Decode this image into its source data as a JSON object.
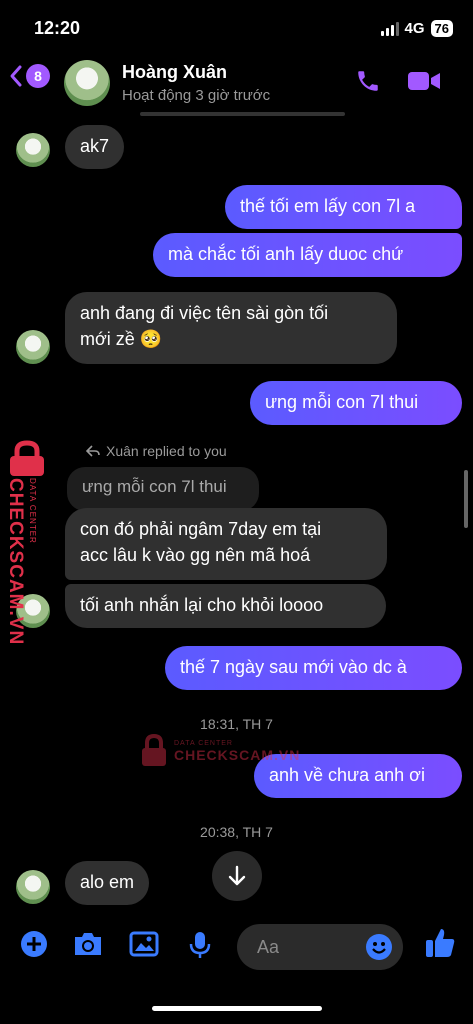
{
  "status": {
    "time": "12:20",
    "network": "4G",
    "battery": "76"
  },
  "header": {
    "back_badge": "8",
    "name": "Hoàng Xuân",
    "subtitle": "Hoạt động 3 giờ trước"
  },
  "messages": [
    {
      "from": "in",
      "text": "ak7"
    },
    {
      "from": "out",
      "text": "thế tối em lấy con 7l a"
    },
    {
      "from": "out",
      "text": "mà chắc tối anh lấy duoc chứ"
    },
    {
      "from": "in",
      "line1": "anh đang đi việc tên sài gòn tối",
      "line2": "mới zề 🥺"
    },
    {
      "from": "out",
      "text": "ưng mỗi con 7l thui"
    },
    {
      "from": "in",
      "reply_label": "Xuân replied to you",
      "quoted": "ưng mỗi con 7l thui",
      "line1": "con đó phải ngâm 7day em tại",
      "line2": "acc lâu k vào gg nên mã hoá"
    },
    {
      "from": "in",
      "text": "tối anh nhắn lại cho khỏi loooo"
    },
    {
      "from": "out",
      "text": "thế 7 ngày sau mới vào dc à"
    },
    {
      "from": "timestamp",
      "text": "18:31, TH 7"
    },
    {
      "from": "out",
      "text": "anh về chưa anh ơi"
    },
    {
      "from": "timestamp",
      "text": "20:38, TH 7"
    },
    {
      "from": "in",
      "text": "alo em"
    }
  ],
  "composer": {
    "placeholder": "Aa"
  },
  "watermark": {
    "brand": "CHECKSCAM.VN",
    "sub": "DATA CENTER"
  },
  "colors": {
    "accent": "#a259ff",
    "outgoing": "#6a55ff",
    "incoming": "#303030",
    "watermark": "#e0304a"
  },
  "icons": [
    "back-chevron-icon",
    "phone-icon",
    "video-icon",
    "reply-icon",
    "arrow-down-icon",
    "plus-icon",
    "camera-icon",
    "image-icon",
    "microphone-icon",
    "emoji-icon",
    "thumbs-up-icon"
  ]
}
